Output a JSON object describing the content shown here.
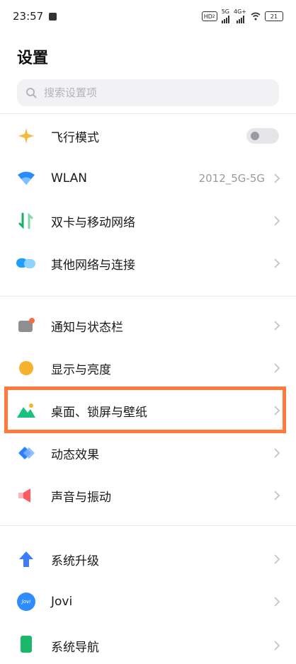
{
  "status": {
    "time": "23:57",
    "hd": "HD",
    "hd_sub": "2",
    "sig1": "5G",
    "sig2": "4G+",
    "battery": "21"
  },
  "page": {
    "title": "设置"
  },
  "search": {
    "placeholder": "搜索设置项"
  },
  "items": [
    {
      "label": "飞行模式",
      "value": "",
      "control": "toggle",
      "toggle_on": false,
      "icon": "airplane-icon",
      "color": "#f6b93b"
    },
    {
      "label": "WLAN",
      "value": "2012_5G-5G",
      "control": "chevron",
      "icon": "wifi-icon",
      "color": "#2a8cff"
    },
    {
      "label": "双卡与移动网络",
      "value": "",
      "control": "chevron",
      "icon": "dual-sim-icon",
      "color": "#16b26b"
    },
    {
      "label": "其他网络与连接",
      "value": "",
      "control": "chevron",
      "icon": "connection-icon",
      "color": "#1ea0ff"
    },
    {
      "label": "通知与状态栏",
      "value": "",
      "control": "chevron",
      "icon": "notification-icon",
      "color": "#8e8e93"
    },
    {
      "label": "显示与亮度",
      "value": "",
      "control": "chevron",
      "icon": "brightness-icon",
      "color": "#f8b12c"
    },
    {
      "label": "桌面、锁屏与壁纸",
      "value": "",
      "control": "chevron",
      "icon": "wallpaper-icon",
      "color": "#19c37d"
    },
    {
      "label": "动态效果",
      "value": "",
      "control": "chevron",
      "icon": "motion-icon",
      "color": "#2f7dff"
    },
    {
      "label": "声音与振动",
      "value": "",
      "control": "chevron",
      "icon": "sound-icon",
      "color": "#ff5a5f"
    },
    {
      "label": "系统升级",
      "value": "",
      "control": "chevron",
      "icon": "upgrade-icon",
      "color": "#3d7bff"
    },
    {
      "label": "Jovi",
      "value": "",
      "control": "chevron",
      "icon": "jovi-icon",
      "color": "#2f8cff",
      "icon_text": "Jovi"
    },
    {
      "label": "系统导航",
      "value": "",
      "control": "chevron",
      "icon": "navigation-icon",
      "color": "#19b86a"
    }
  ],
  "colors": {
    "highlight": "#ff7a3b"
  }
}
